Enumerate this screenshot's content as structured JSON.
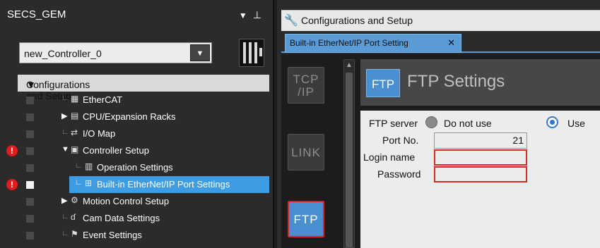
{
  "left_panel": {
    "title": "SECS_GEM",
    "controller": "new_Controller_0",
    "tree": {
      "root": "Configurations and Setup",
      "items": [
        {
          "label": "EtherCAT",
          "icon": "ethercat-icon",
          "glyph": "▦"
        },
        {
          "label": "CPU/Expansion Racks",
          "icon": "rack-icon",
          "glyph": "▤"
        },
        {
          "label": "I/O Map",
          "icon": "io-map-icon",
          "glyph": "⇄"
        },
        {
          "label": "Controller Setup",
          "icon": "controller-setup-icon",
          "glyph": "▣"
        },
        {
          "label": "Operation Settings",
          "icon": "operation-settings-icon",
          "glyph": "▥"
        },
        {
          "label": "Built-in EtherNet/IP Port Settings",
          "icon": "ethernet-port-icon",
          "glyph": "⊞"
        },
        {
          "label": "Motion Control Setup",
          "icon": "motion-gear-icon",
          "glyph": "⚙"
        },
        {
          "label": "Cam Data Settings",
          "icon": "cam-icon",
          "glyph": "ɗ"
        },
        {
          "label": "Event Settings",
          "icon": "event-flag-icon",
          "glyph": "⚑"
        }
      ]
    }
  },
  "right_panel": {
    "window_title": "Configurations and Setup",
    "tab_label": "Built-in EtherNet/IP Port Setting",
    "side_tabs": [
      {
        "line1": "TCP",
        "line2": "/IP"
      },
      {
        "line1": "LINK",
        "line2": ""
      },
      {
        "line1": "FTP",
        "line2": ""
      }
    ],
    "section_badge": "FTP",
    "section_title": "FTP Settings",
    "form": {
      "ftp_server_label": "FTP server",
      "option_do_not_use": "Do not use",
      "option_use": "Use",
      "port_label": "Port No.",
      "port_value": "21",
      "login_label": "Login name",
      "login_value": "",
      "password_label": "Password",
      "password_value": ""
    }
  },
  "colors": {
    "accent": "#3e9de2",
    "error": "#e11d1d"
  }
}
